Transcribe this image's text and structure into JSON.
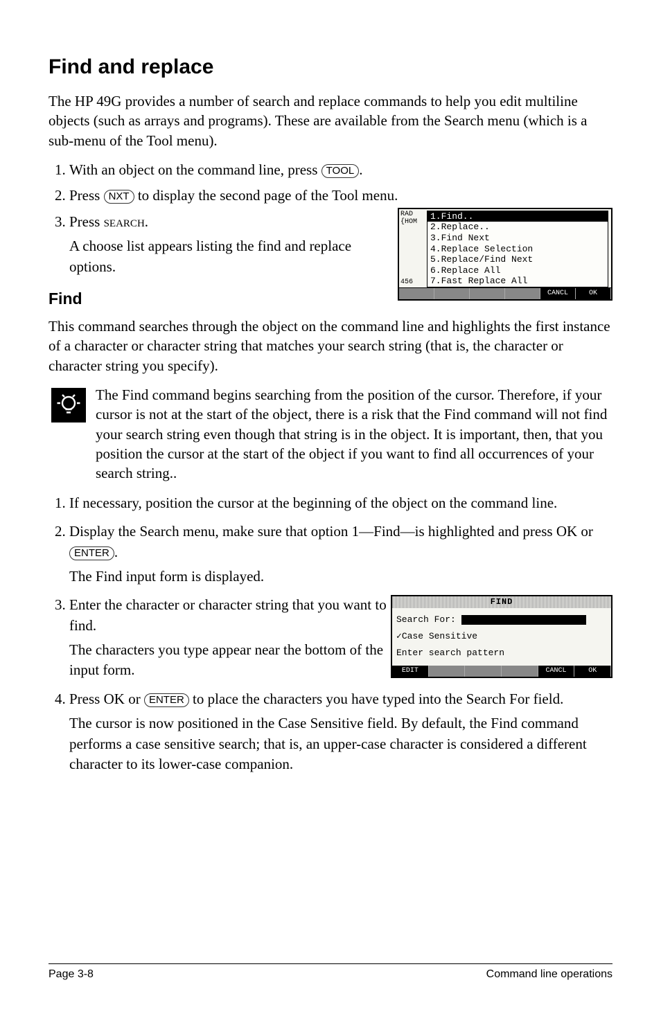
{
  "title": "Find and replace",
  "intro": "The HP 49G provides a number of search and replace commands to help you edit multiline objects (such as arrays and programs). These are available from the Search menu (which is a sub-menu of the Tool menu).",
  "steps_main": {
    "s1a": "With an object on the command line, press ",
    "s1key": "TOOL",
    "s1b": ".",
    "s2a": "Press ",
    "s2key": "NXT",
    "s2b": " to display the second page of the Tool menu.",
    "s3a": "Press ",
    "s3word": "search",
    "s3b": ".",
    "s3c": "A choose list appears listing the find and replace options."
  },
  "scr1": {
    "left_top1": "RAD",
    "left_top2": "{HOM",
    "left_bottom": "456",
    "menu": [
      "1.Find..",
      "2.Replace..",
      "3.Find Next",
      "4.Replace Selection",
      "5.Replace/Find Next",
      "6.Replace All",
      "7.Fast Replace All"
    ],
    "soft": [
      "",
      "",
      "",
      "",
      "CANCL",
      "OK"
    ]
  },
  "find_heading": "Find",
  "find_para": "This command searches through the object on the command line and highlights the first instance of a character or character string that matches your search string (that is, the character or character string you specify).",
  "tip": "The Find command begins searching from the position of the cursor. Therefore, if your cursor is not at the start of the object, there is a risk that the Find command will not find your search string even though that string is in the object. It is important, then, that you position the cursor at the start of the object if you want to find all occurrences of your search string..",
  "find_steps": {
    "f1": "If necessary, position the cursor at the beginning of the object on the command line.",
    "f2a": "Display the Search menu, make sure that option 1—Find—is highlighted and press ",
    "f2ok": "OK",
    "f2or": " or ",
    "f2key": "ENTER",
    "f2b": ".",
    "f2c": "The Find input form is displayed.",
    "f3a": "Enter the character or character string that you want to find.",
    "f3b": "The characters you type appear near the bottom of the input form.",
    "f4a": "Press ",
    "f4ok": "OK",
    "f4or": " or ",
    "f4key": "ENTER",
    "f4b": " to place the characters you have typed into the Search For field.",
    "f4c": "The cursor is now positioned in the Case Sensitive field. By default, the Find command performs a case sensitive search; that is, an upper-case character is considered a different character to its lower-case companion."
  },
  "scr2": {
    "title": "FIND",
    "search_for": "Search For:",
    "case": "✓Case Sensitive",
    "prompt": "Enter search pattern",
    "soft": [
      "EDIT",
      "",
      "",
      "",
      "CANCL",
      "OK"
    ]
  },
  "footer_left": "Page 3-8",
  "footer_right": "Command line operations"
}
